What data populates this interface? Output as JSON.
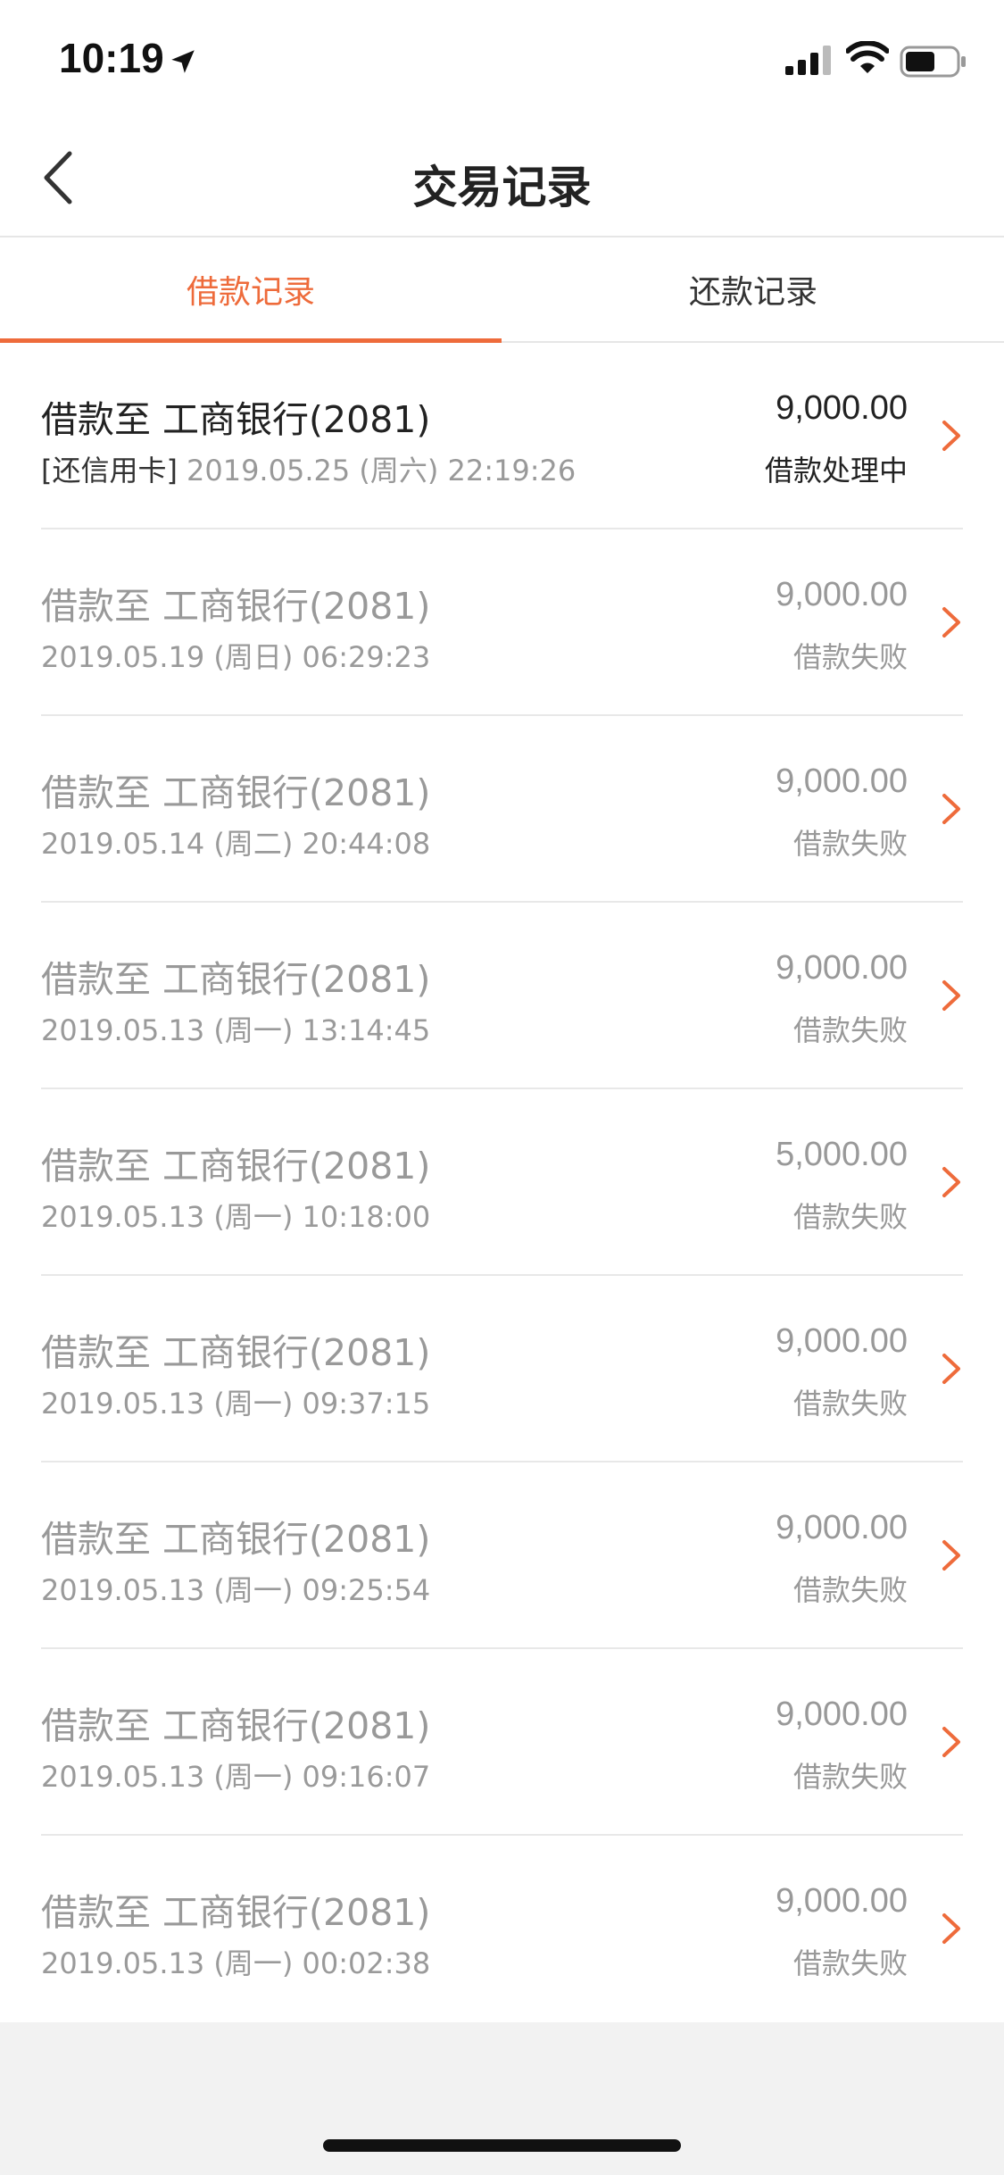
{
  "status_bar": {
    "time": "10:19"
  },
  "nav": {
    "title": "交易记录"
  },
  "tabs": [
    {
      "label": "借款记录",
      "active": true
    },
    {
      "label": "还款记录",
      "active": false
    }
  ],
  "records": [
    {
      "title": "借款至 工商银行(2081)",
      "tag": "[还信用卡]",
      "datetime": "2019.05.25 (周六) 22:19:26",
      "amount": "9,000.00",
      "status": "借款处理中",
      "active": true
    },
    {
      "title": "借款至 工商银行(2081)",
      "tag": "",
      "datetime": "2019.05.19 (周日) 06:29:23",
      "amount": "9,000.00",
      "status": "借款失败",
      "active": false
    },
    {
      "title": "借款至 工商银行(2081)",
      "tag": "",
      "datetime": "2019.05.14 (周二) 20:44:08",
      "amount": "9,000.00",
      "status": "借款失败",
      "active": false
    },
    {
      "title": "借款至 工商银行(2081)",
      "tag": "",
      "datetime": "2019.05.13 (周一) 13:14:45",
      "amount": "9,000.00",
      "status": "借款失败",
      "active": false
    },
    {
      "title": "借款至 工商银行(2081)",
      "tag": "",
      "datetime": "2019.05.13 (周一) 10:18:00",
      "amount": "5,000.00",
      "status": "借款失败",
      "active": false
    },
    {
      "title": "借款至 工商银行(2081)",
      "tag": "",
      "datetime": "2019.05.13 (周一) 09:37:15",
      "amount": "9,000.00",
      "status": "借款失败",
      "active": false
    },
    {
      "title": "借款至 工商银行(2081)",
      "tag": "",
      "datetime": "2019.05.13 (周一) 09:25:54",
      "amount": "9,000.00",
      "status": "借款失败",
      "active": false
    },
    {
      "title": "借款至 工商银行(2081)",
      "tag": "",
      "datetime": "2019.05.13 (周一) 09:16:07",
      "amount": "9,000.00",
      "status": "借款失败",
      "active": false
    },
    {
      "title": "借款至 工商银行(2081)",
      "tag": "",
      "datetime": "2019.05.13 (周一) 00:02:38",
      "amount": "9,000.00",
      "status": "借款失败",
      "active": false
    }
  ],
  "colors": {
    "accent": "#ee6b3b",
    "text_primary": "#222222",
    "text_muted": "#999999",
    "page_bg": "#f2f2f2"
  },
  "icons": [
    "location-arrow-icon",
    "signal-icon",
    "wifi-icon",
    "battery-icon",
    "back-chevron-icon",
    "chevron-right-icon"
  ]
}
